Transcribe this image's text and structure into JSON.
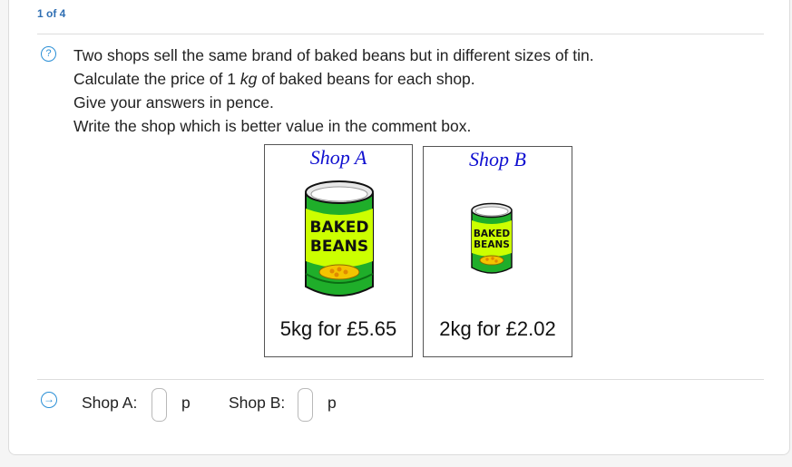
{
  "progress": {
    "counter": "1 of 4"
  },
  "question": {
    "lines": {
      "line1": "Two shops sell the same brand of baked beans but in different sizes of tin.",
      "line2_pre": "Calculate the price of 1 ",
      "line2_unit": "kg",
      "line2_post": " of baked beans for each shop.",
      "line3": "Give your answers in pence.",
      "line4": "Write the shop which is better value in the comment box."
    },
    "icon": "question-circle-icon"
  },
  "shops": [
    {
      "name": "Shop A",
      "price_text": "5kg for £5.65",
      "tin_label_top": "BAKED",
      "tin_label_bottom": "BEANS"
    },
    {
      "name": "Shop B",
      "price_text": "2kg for £2.02",
      "tin_label_top": "BAKED",
      "tin_label_bottom": "BEANS"
    }
  ],
  "answer": {
    "icon": "arrow-right-circle-icon",
    "shop_a_label": "Shop A:",
    "shop_a_unit": "p",
    "shop_a_value": "",
    "shop_b_label": "Shop B:",
    "shop_b_unit": "p",
    "shop_b_value": ""
  },
  "colors": {
    "accent": "#2a8fd6",
    "shop_name": "#1010d0",
    "tin_green": "#1fae2a",
    "label_yellow": "#ccff00"
  }
}
